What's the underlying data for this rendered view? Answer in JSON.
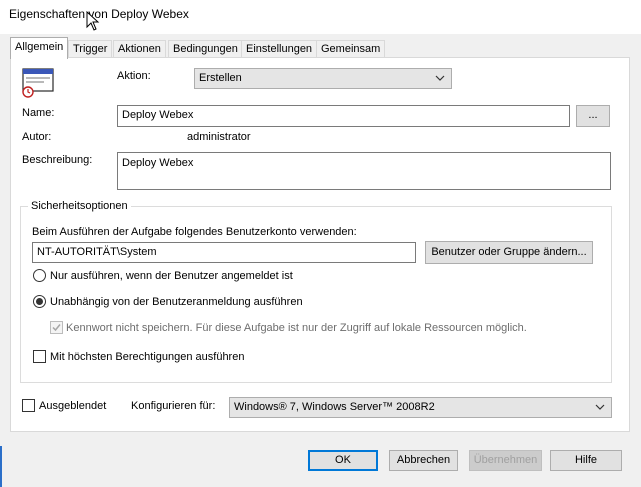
{
  "window": {
    "title": "Eigenschaften von Deploy Webex"
  },
  "tabs": [
    {
      "label": "Allgemein",
      "active": true
    },
    {
      "label": "Trigger",
      "active": false
    },
    {
      "label": "Aktionen",
      "active": false
    },
    {
      "label": "Bedingungen",
      "active": false
    },
    {
      "label": "Einstellungen",
      "active": false
    },
    {
      "label": "Gemeinsam",
      "active": false
    }
  ],
  "general": {
    "task_icon": "scheduled-task-icon",
    "action_label": "Aktion:",
    "action_value": "Erstellen",
    "name_label": "Name:",
    "name_value": "Deploy Webex",
    "browse_label": "...",
    "author_label": "Autor:",
    "author_value": "administrator",
    "description_label": "Beschreibung:",
    "description_value": "Deploy Webex"
  },
  "security": {
    "group_label": "Sicherheitsoptionen",
    "run_as_label": "Beim Ausführen der Aufgabe folgendes Benutzerkonto verwenden:",
    "account_value": "NT-AUTORITÄT\\System",
    "change_user_label": "Benutzer oder Gruppe ändern...",
    "radio_logged_on": "Nur ausführen, wenn der Benutzer angemeldet ist",
    "radio_independent": "Unabhängig von der Benutzeranmeldung ausführen",
    "selected_radio": "independent",
    "no_password_label": "Kennwort nicht speichern. Für diese Aufgabe ist nur der Zugriff auf lokale Ressourcen möglich.",
    "no_password_checked": true,
    "no_password_enabled": false,
    "highest_privileges_label": "Mit höchsten Berechtigungen ausführen",
    "highest_privileges_checked": false
  },
  "bottom": {
    "hidden_label": "Ausgeblendet",
    "hidden_checked": false,
    "configure_label": "Konfigurieren für:",
    "configure_value": "Windows® 7, Windows Server™ 2008R2"
  },
  "buttons": {
    "ok": "OK",
    "cancel": "Abbrechen",
    "apply": "Übernehmen",
    "help": "Hilfe"
  },
  "colors": {
    "accent": "#0078d7",
    "dialog_bg": "#f0f0f0",
    "panel_bg": "#ffffff"
  }
}
